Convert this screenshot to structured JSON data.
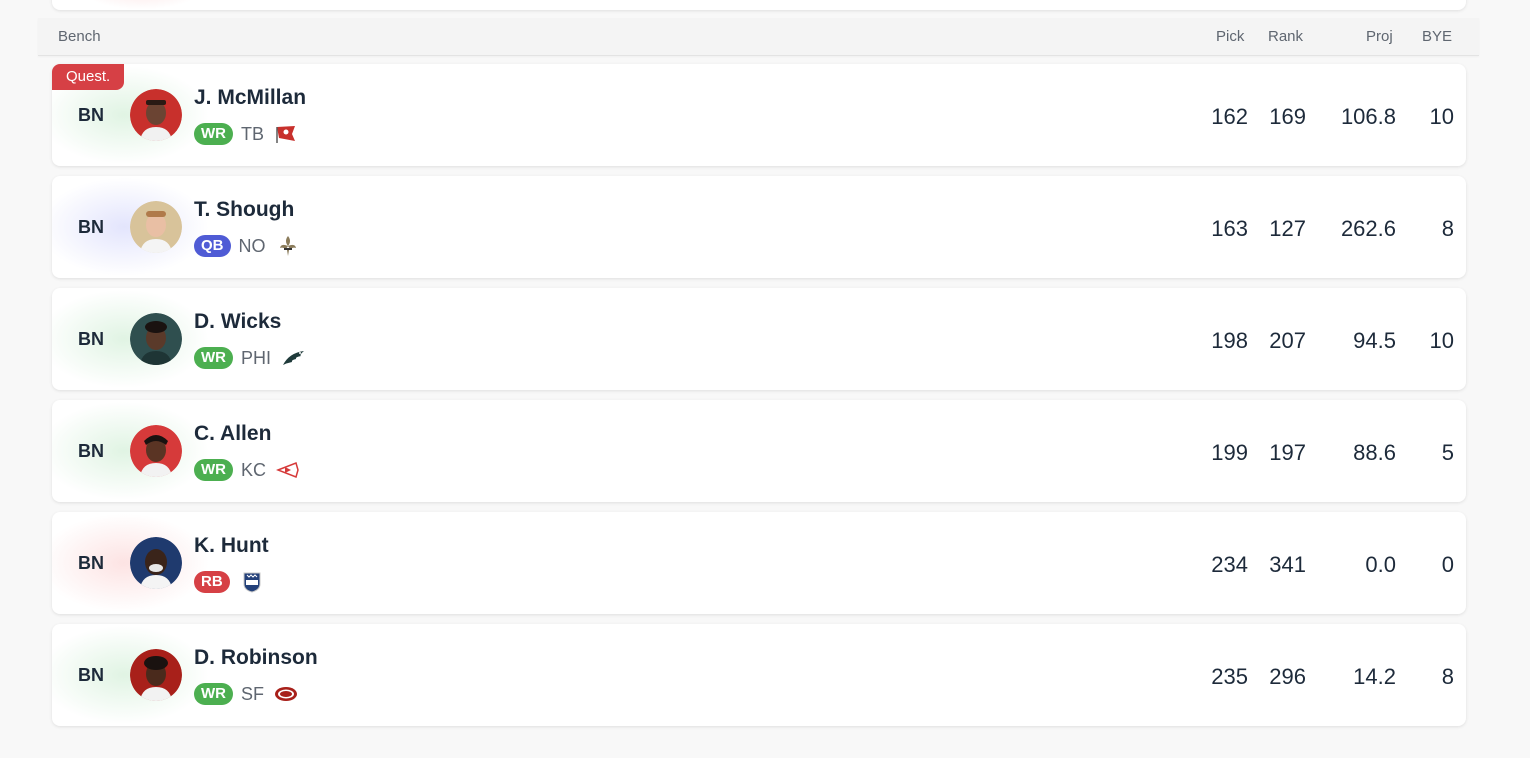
{
  "header": {
    "title": "Bench",
    "columns": [
      "Pick",
      "Rank",
      "Proj",
      "BYE"
    ]
  },
  "colors": {
    "wr": "#4caf50",
    "qb": "#4f5bd5",
    "rb": "#d64045",
    "questionable": "#d64045"
  },
  "players": [
    {
      "slot": "BN",
      "status": "Quest.",
      "name": "J. McMillan",
      "pos": "WR",
      "team": "TB",
      "team_logo": "buccaneers-flag-icon",
      "pick": "162",
      "rank": "169",
      "proj": "106.8",
      "bye": "10"
    },
    {
      "slot": "BN",
      "status": "",
      "name": "T. Shough",
      "pos": "QB",
      "team": "NO",
      "team_logo": "fleur-de-lis-icon",
      "pick": "163",
      "rank": "127",
      "proj": "262.6",
      "bye": "8"
    },
    {
      "slot": "BN",
      "status": "",
      "name": "D. Wicks",
      "pos": "WR",
      "team": "PHI",
      "team_logo": "eagle-wing-icon",
      "pick": "198",
      "rank": "207",
      "proj": "94.5",
      "bye": "10"
    },
    {
      "slot": "BN",
      "status": "",
      "name": "C. Allen",
      "pos": "WR",
      "team": "KC",
      "team_logo": "arrowhead-icon",
      "pick": "199",
      "rank": "197",
      "proj": "88.6",
      "bye": "5"
    },
    {
      "slot": "BN",
      "status": "",
      "name": "K. Hunt",
      "pos": "RB",
      "team": "",
      "team_logo": "nfl-shield-icon",
      "pick": "234",
      "rank": "341",
      "proj": "0.0",
      "bye": "0"
    },
    {
      "slot": "BN",
      "status": "",
      "name": "D. Robinson",
      "pos": "WR",
      "team": "SF",
      "team_logo": "sf-oval-icon",
      "pick": "235",
      "rank": "296",
      "proj": "14.2",
      "bye": "8"
    }
  ]
}
